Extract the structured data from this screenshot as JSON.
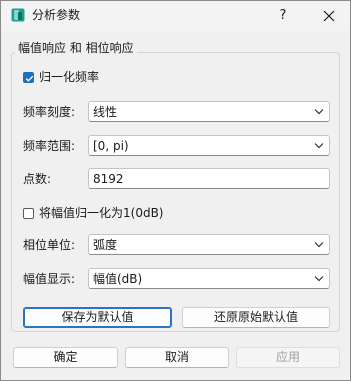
{
  "window": {
    "title": "分析参数",
    "help_label": "?",
    "icon": "app-icon",
    "accent": "#1f6fc1"
  },
  "group": {
    "title": "幅值响应 和 相位响应"
  },
  "normalize_freq": {
    "label": "归一化频率",
    "checked": true
  },
  "freq_scale": {
    "label": "频率刻度:",
    "value": "线性"
  },
  "freq_range": {
    "label": "频率范围:",
    "value": "[0, pi)"
  },
  "points": {
    "label": "点数:",
    "value": "8192"
  },
  "normalize_mag": {
    "label": "将幅值归一化为1(0dB)",
    "checked": false
  },
  "phase_unit": {
    "label": "相位单位:",
    "value": "弧度"
  },
  "mag_display": {
    "label": "幅值显示:",
    "value": "幅值(dB)"
  },
  "buttons": {
    "save_default": "保存为默认值",
    "restore_default": "还原原始默认值",
    "ok": "确定",
    "cancel": "取消",
    "apply": "应用"
  }
}
